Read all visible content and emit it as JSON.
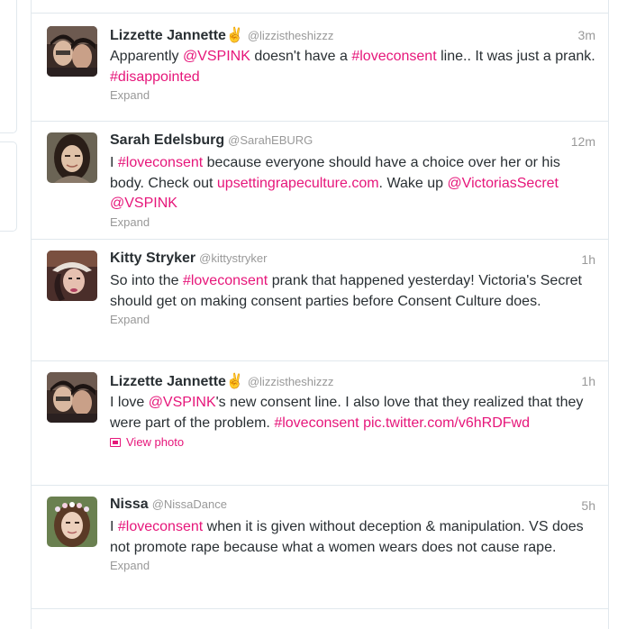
{
  "tweets": [
    {
      "fullname": "Lizzette Jannette✌",
      "username": "@lizzistheshizzz",
      "time": "3m",
      "avatar": "avatar-two-women-selfie",
      "segments": [
        {
          "t": "Apparently "
        },
        {
          "t": "@VSPINK",
          "link": true
        },
        {
          "t": " doesn't have a "
        },
        {
          "t": "#loveconsent",
          "link": true
        },
        {
          "t": " line.. It was just a prank. "
        },
        {
          "t": "#disappointed",
          "link": true
        }
      ],
      "action": "Expand"
    },
    {
      "fullname": "Sarah Edelsburg",
      "username": "@SarahEBURG",
      "time": "12m",
      "avatar": "avatar-woman-dark-hair",
      "segments": [
        {
          "t": "I "
        },
        {
          "t": "#loveconsent",
          "link": true
        },
        {
          "t": " because everyone should have a choice over her or his body. Check out "
        },
        {
          "t": "upsettingrapeculture.com",
          "link": true
        },
        {
          "t": ". Wake up "
        },
        {
          "t": "@VictoriasSecret",
          "link": true
        },
        {
          "t": " "
        },
        {
          "t": "@VSPINK",
          "link": true
        }
      ],
      "action": "Expand"
    },
    {
      "fullname": "Kitty Stryker",
      "username": "@kittystryker",
      "time": "1h",
      "avatar": "avatar-woman-hat",
      "segments": [
        {
          "t": "So into the "
        },
        {
          "t": "#loveconsent",
          "link": true
        },
        {
          "t": " prank that happened yesterday! Victoria's Secret should get on making consent parties before Consent Culture does."
        }
      ],
      "action": "Expand"
    },
    {
      "fullname": "Lizzette Jannette✌",
      "username": "@lizzistheshizzz",
      "time": "1h",
      "avatar": "avatar-two-women-selfie",
      "segments": [
        {
          "t": "I love "
        },
        {
          "t": "@VSPINK",
          "link": true
        },
        {
          "t": "'s new consent line. I also love that they realized that they were part of the problem. "
        },
        {
          "t": "#loveconsent",
          "link": true
        },
        {
          "t": " "
        },
        {
          "t": "pic.twitter.com/v6hRDFwd",
          "link": true
        }
      ],
      "action": "View photo",
      "action_is_photo": true
    },
    {
      "fullname": "Nissa",
      "username": "@NissaDance",
      "time": "5h",
      "avatar": "avatar-woman-flower-crown",
      "segments": [
        {
          "t": "I "
        },
        {
          "t": "#loveconsent",
          "link": true
        },
        {
          "t": " when it is given without deception & manipulation. VS does not promote rape because what a women wears does not cause rape."
        }
      ],
      "action": "Expand"
    }
  ],
  "colors": {
    "link": "#e6167a",
    "meta": "#999999",
    "border": "#e1e8ed"
  }
}
